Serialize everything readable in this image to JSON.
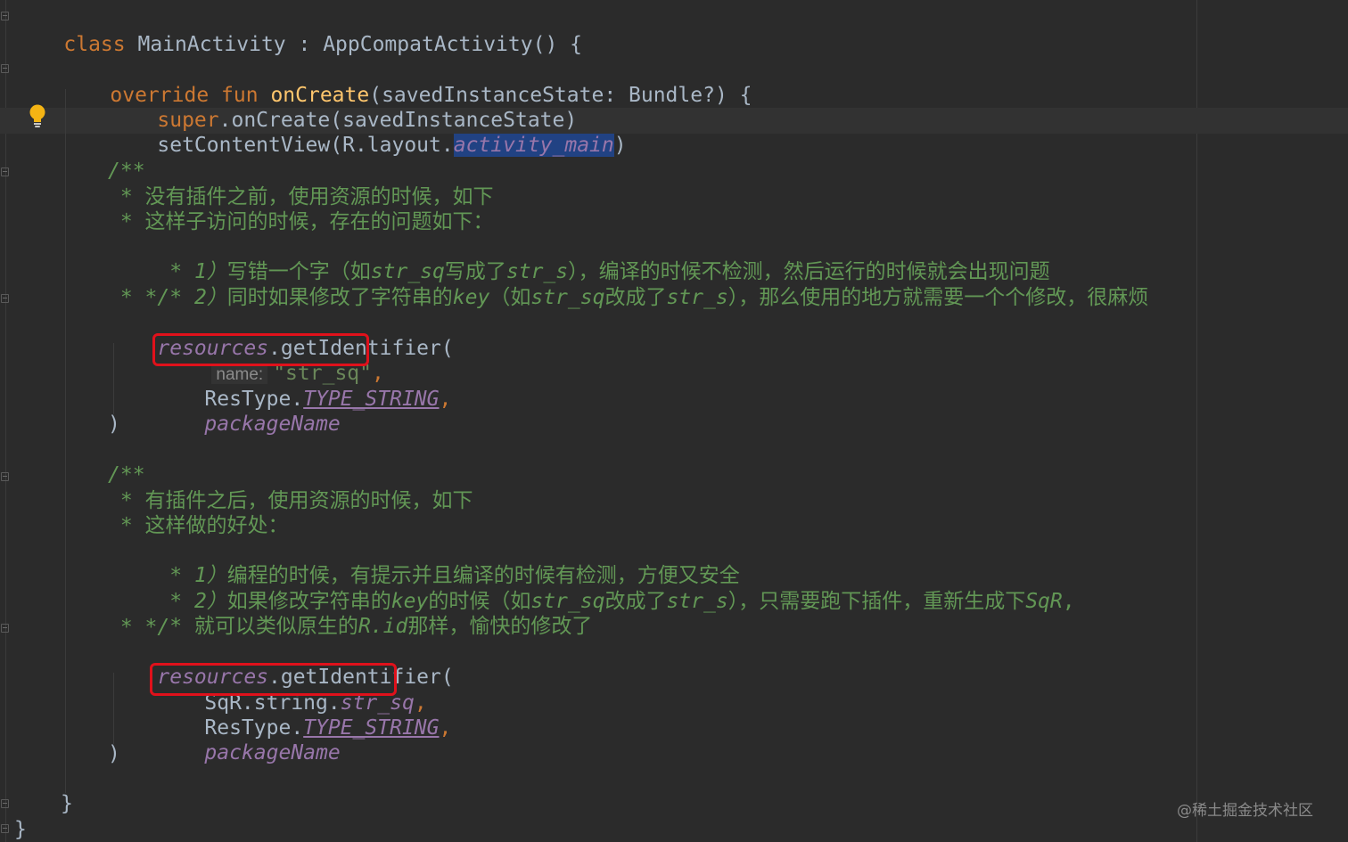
{
  "editor": {
    "language": "Kotlin",
    "theme": "Darcula",
    "colors": {
      "background": "#2b2b2b",
      "keyword": "#cc7832",
      "function": "#ffc66d",
      "plain": "#a9b7c6",
      "property": "#9876aa",
      "string": "#6a8759",
      "doc_comment": "#629755",
      "selection": "#214283",
      "highlight_box": "#e0111b"
    },
    "code": {
      "l1": {
        "kw": "class",
        "rest": " MainActivity : AppCompatActivity() {"
      },
      "l2": {
        "kw1": "override",
        "kw2": "fun",
        "name": "onCreate",
        "rest": "(savedInstanceState: Bundle?) {"
      },
      "l3": {
        "kw": "super",
        "rest": ".onCreate(savedInstanceState)"
      },
      "l4": {
        "pre": "setContentView(R.layout.",
        "sel": "activity_main",
        "post": ")"
      },
      "c1": {
        "open": "/**",
        "l1": " * 没有插件之前，使用资源的时候，如下",
        "l2": " * 这样子访问的时候，存在的问题如下：",
        "l3a": " * ",
        "l3b": "1）",
        "l3c": "写错一个字（如",
        "l3d": "str_sq",
        "l3e": "写成了",
        "l3f": "str_s",
        "l3g": "），编译的时候不检测，然后运行的时候就会出现问题",
        "l4a": " * ",
        "l4b": "2）",
        "l4c": "同时如果修改了字符串的",
        "l4d": "key",
        "l4e": "（如",
        "l4f": "str_sq",
        "l4g": "改成了",
        "l4h": "str_s",
        "l4i": "），那么使用的地方就需要一个个修改，很麻烦",
        "close": " * */"
      },
      "b1": {
        "recv": "resources",
        "call": ".getIdentifier(",
        "hint": "name:",
        "str": "\"str_sq\"",
        "comma": ",",
        "restype": "ResType.",
        "restype_const": "TYPE_STRING",
        "comma2": ",",
        "pkg": "packageName",
        "close": ")"
      },
      "c2": {
        "open": "/**",
        "l1": " * 有插件之后，使用资源的时候，如下",
        "l2": " * 这样做的好处：",
        "l3a": " * ",
        "l3b": "1）",
        "l3c": "编程的时候，有提示并且编译的时候有检测，方便又安全",
        "l4a": " * ",
        "l4b": "2）",
        "l4c": "如果修改字符串的",
        "l4d": "key",
        "l4e": "的时候（如",
        "l4f": "str_sq",
        "l4g": "改成了",
        "l4h": "str_s",
        "l4i": "），只需要跑下插件，重新生成下",
        "l4j": "SqR",
        "l4k": ",",
        "l5a": " * 就可以类似原生的",
        "l5b": "R.id",
        "l5c": "那样，愉快的修改了",
        "close": " * */"
      },
      "b2": {
        "recv": "resources",
        "call": ".getIdentifier(",
        "sqr": "SqR.string.",
        "field": "str_sq",
        "comma": ",",
        "restype": "ResType.",
        "restype_const": "TYPE_STRING",
        "comma2": ",",
        "pkg": "packageName",
        "close": ")"
      },
      "fun_close": "}",
      "class_close": "}"
    }
  },
  "watermark": "@稀土掘金技术社区",
  "icons": {
    "intention_bulb": "lightbulb-icon",
    "fold_markers": "fold-marker-icon"
  }
}
